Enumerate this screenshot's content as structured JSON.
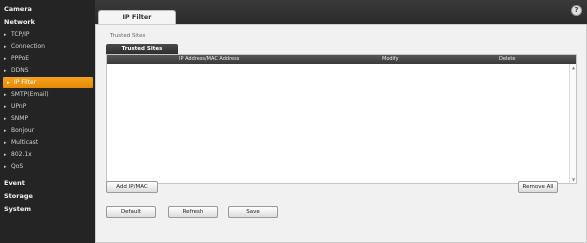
{
  "sidebar": {
    "items": [
      {
        "label": "Camera",
        "kind": "cat"
      },
      {
        "label": "Network",
        "kind": "cat"
      },
      {
        "label": "TCP/IP",
        "kind": "sub"
      },
      {
        "label": "Connection",
        "kind": "sub"
      },
      {
        "label": "PPPoE",
        "kind": "sub"
      },
      {
        "label": "DDNS",
        "kind": "sub"
      },
      {
        "label": "IP Filter",
        "kind": "sub",
        "active": true
      },
      {
        "label": "SMTP(Email)",
        "kind": "sub"
      },
      {
        "label": "UPnP",
        "kind": "sub"
      },
      {
        "label": "SNMP",
        "kind": "sub"
      },
      {
        "label": "Bonjour",
        "kind": "sub"
      },
      {
        "label": "Multicast",
        "kind": "sub"
      },
      {
        "label": "802.1x",
        "kind": "sub"
      },
      {
        "label": "QoS",
        "kind": "sub"
      },
      {
        "label": "Event",
        "kind": "cat"
      },
      {
        "label": "Storage",
        "kind": "cat"
      },
      {
        "label": "System",
        "kind": "cat"
      }
    ]
  },
  "header": {
    "tab_label": "IP Filter",
    "help_glyph": "?"
  },
  "main": {
    "section_label": "Trusted Sites",
    "subtab_label": "Trusted Sites",
    "table": {
      "columns": [
        "IP Address/MAC Address",
        "Modify",
        "Delete"
      ],
      "rows": []
    },
    "buttons": {
      "add": "Add IP/MAC",
      "remove_all": "Remove All",
      "default": "Default",
      "refresh": "Refresh",
      "save": "Save"
    }
  },
  "colors": {
    "active_item": "#f39a14",
    "sidebar_bg": "#242424"
  }
}
